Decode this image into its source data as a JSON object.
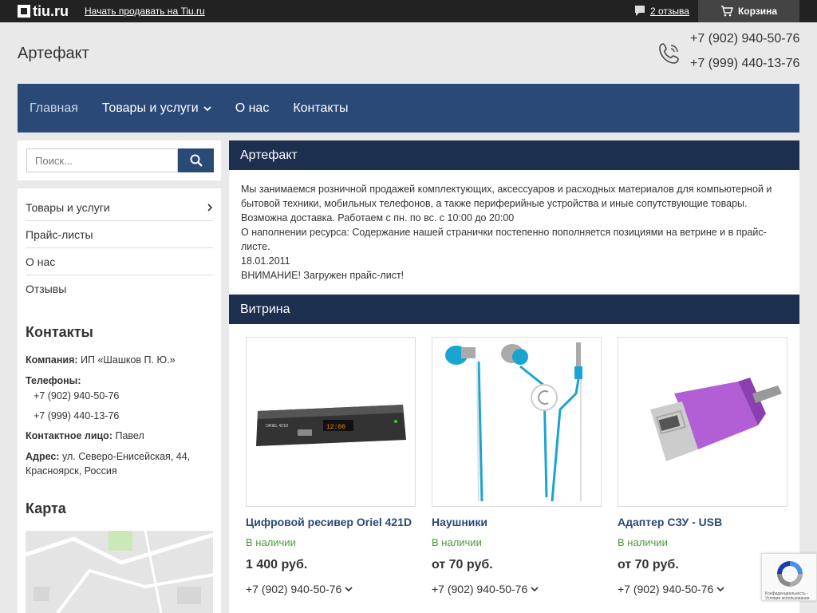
{
  "topbar": {
    "logo_text": "tiu.ru",
    "sell_link": "Начать продавать на Tiu.ru",
    "reviews_label": "2 отзыва",
    "cart_label": "Корзина"
  },
  "header": {
    "shop_name": "Артефакт",
    "phones": [
      "+7 (902) 940-50-76",
      "+7 (999) 440-13-76"
    ]
  },
  "nav": {
    "items": [
      {
        "label": "Главная"
      },
      {
        "label": "Товары и услуги"
      },
      {
        "label": "О нас"
      },
      {
        "label": "Контакты"
      }
    ]
  },
  "search": {
    "placeholder": "Поиск..."
  },
  "sidebar": {
    "menu": [
      {
        "label": "Товары и услуги"
      },
      {
        "label": "Прайс-листы"
      },
      {
        "label": "О нас"
      },
      {
        "label": "Отзывы"
      }
    ],
    "contacts_title": "Контакты",
    "company_label": "Компания:",
    "company_value": "ИП «Шашков П. Ю.»",
    "phones_label": "Телефоны:",
    "phones": [
      "+7 (902) 940-50-76",
      "+7 (999) 440-13-76"
    ],
    "person_label": "Контактное лицо:",
    "person_value": "Павел",
    "address_label": "Адрес:",
    "address_value": "ул. Северо-Енисейская, 44, Красноярск, Россия",
    "map_title": "Карта"
  },
  "main": {
    "about_title": "Артефакт",
    "about_lines": [
      "Мы занимаемся розничной продажей комплектующих, аксессуаров и расходных материалов для компьютерной и бытовой техники, мобильных телефонов, а также периферийные устройства и иные сопутствующие товары.",
      "Возможна доставка. Работаем с пн. по вс. с 10:00 до 20:00",
      "О наполнении ресурса: Содержание нашей странички постепенно пополняется позициями на ветрине и в прайс-листе.",
      "18.01.2011",
      "ВНИМАНИЕ! Загружен прайс-лист!"
    ],
    "showcase_title": "Витрина",
    "products": [
      {
        "name": "Цифровой ресивер Oriel 421D",
        "stock": "В наличии",
        "price": "1 400 руб.",
        "phone": "+7 (902) 940-50-76",
        "image_label": "ORIEL 421D",
        "display_text": "12:00"
      },
      {
        "name": "Наушники",
        "stock": "В наличии",
        "price": "от 70 руб.",
        "phone": "+7 (902) 940-50-76"
      },
      {
        "name": "Адаптер СЗУ - USB",
        "stock": "В наличии",
        "price": "от 70 руб.",
        "phone": "+7 (902) 940-50-76"
      }
    ]
  },
  "recaptcha": {
    "text": "Конфиденциальность - Условия использования"
  },
  "colors": {
    "nav_bg": "#2a4976",
    "section_header_bg": "#1c2f4e",
    "in_stock": "#4a9a3a",
    "topbar_bg": "#222222"
  },
  "icons": [
    "comment-icon",
    "cart-icon",
    "phone-icon",
    "chevron-down-icon",
    "search-icon",
    "chevron-right-icon"
  ]
}
